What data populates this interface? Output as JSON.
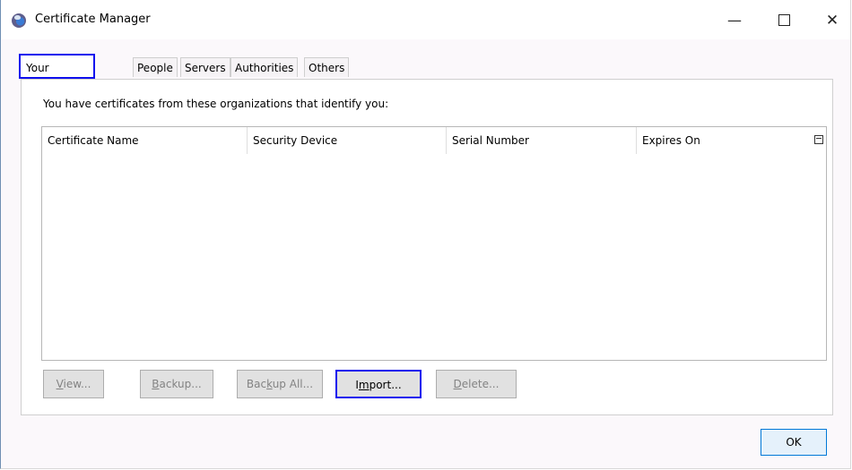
{
  "window": {
    "title": "Certificate Manager",
    "minimize_glyph": "—",
    "close_glyph": "✕"
  },
  "tabs": [
    {
      "label": "Your Certificates",
      "active": true
    },
    {
      "label": "People",
      "active": false
    },
    {
      "label": "Servers",
      "active": false
    },
    {
      "label": "Authorities",
      "active": false
    },
    {
      "label": "Others",
      "active": false
    }
  ],
  "panel": {
    "description": "You have certificates from these organizations that identify you:",
    "columns": [
      "Certificate Name",
      "Security Device",
      "Serial Number",
      "Expires On"
    ],
    "rows": []
  },
  "buttons": {
    "view": {
      "pre": "",
      "key": "V",
      "post": "iew..."
    },
    "backup": {
      "pre": "",
      "key": "B",
      "post": "ackup..."
    },
    "backup_all": {
      "pre": "Bac",
      "key": "k",
      "post": "up All..."
    },
    "import": {
      "pre": "I",
      "key": "m",
      "post": "port..."
    },
    "delete": {
      "pre": "",
      "key": "D",
      "post": "elete..."
    }
  },
  "ok_label": "OK",
  "colors": {
    "highlight": "#1010ee",
    "ok_border": "#0078d7",
    "disabled_text": "#838383"
  }
}
